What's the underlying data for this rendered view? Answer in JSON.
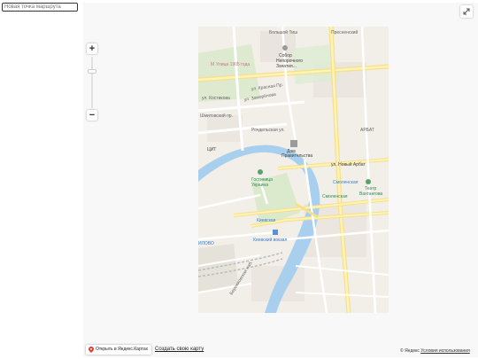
{
  "route_input": {
    "placeholder": "Новая точка маршрута"
  },
  "zoom": {
    "plus": "+",
    "minus": "−"
  },
  "footer": {
    "open_in_maps": "Открыть в Яндекс.Картах",
    "create_map": "Создать свою карту",
    "copyright_prefix": "© Яндекс",
    "terms": "Условия использования"
  },
  "map": {
    "labels": {
      "bolshoy_tish": "Большой Тиш",
      "cathedral": "Собор",
      "cathedral2": "Непорочного",
      "cathedral3": "Зачатия...",
      "ulitsa_1905": "Улица 1905 года",
      "krasnaya_presnya": "ул. Красная Пр.",
      "zamorenova": "ул. Заморёнова",
      "kostikov": "ул. Костикова",
      "shmitovsky": "Шмитовский пр.",
      "rochdelskaya": "Рочдельская ул.",
      "tsit": "ЦИТ",
      "dom_pravitelstva": "Дом",
      "dom_pravitelstva2": "Правительства",
      "noviy_arbat": "ул. Новый Арбат",
      "arbat": "АРБАТ",
      "gostinitsa": "Гостиница",
      "gostinitsa2": "Украина",
      "smolenskaya": "Смоленская",
      "smolenskaya_metro": "Смоленская",
      "teatr": "Театр",
      "teatr2": "Вахтангова",
      "kievskaya": "Киевская",
      "kievsky_vokzal": "Киевский вокзал",
      "dorogomilovo": "ИЛОВО",
      "berezhkovskaya": "Бережковская наб.",
      "presnensky": "Пресненский"
    }
  }
}
